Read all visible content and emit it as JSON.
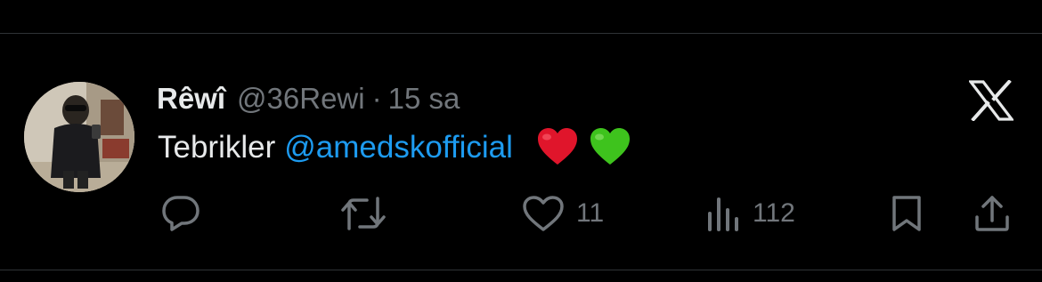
{
  "tweet": {
    "author": {
      "display_name": "Rêwî",
      "handle": "@36Rewi",
      "separator": "·",
      "time": "15 sa"
    },
    "text": {
      "prefix": "Tebrikler",
      "mention": "@amedskofficial",
      "emojis": [
        "red-heart-emoji",
        "green-heart-emoji"
      ]
    },
    "stats": {
      "likes": "11",
      "views": "112"
    }
  },
  "icons": {
    "platform": "x-logo-icon",
    "reply": "reply-icon",
    "retweet": "retweet-icon",
    "like": "like-icon",
    "views": "views-icon",
    "bookmark": "bookmark-icon",
    "share": "share-icon"
  },
  "colors": {
    "background": "#000000",
    "text": "#e7e9ea",
    "muted": "#71767b",
    "link": "#1d9bf0",
    "divider": "#2f3336",
    "heart_red": "#e0152b",
    "heart_green": "#3ec31d"
  }
}
